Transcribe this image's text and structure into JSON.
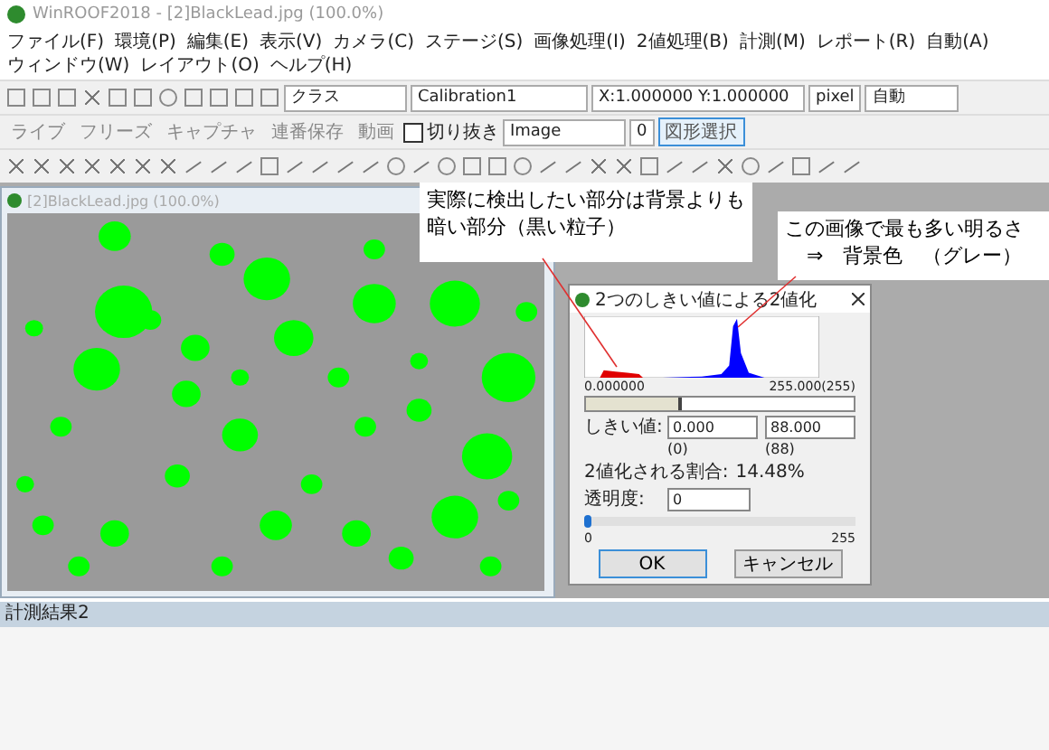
{
  "window": {
    "title": "WinROOF2018 - [2]BlackLead.jpg (100.0%)"
  },
  "menu": [
    "ファイル(F)",
    "環境(P)",
    "編集(E)",
    "表示(V)",
    "カメラ(C)",
    "ステージ(S)",
    "画像処理(I)",
    "2値処理(B)",
    "計測(M)",
    "レポート(R)",
    "自動(A)",
    "ウィンドウ(W)",
    "レイアウト(O)",
    "ヘルプ(H)"
  ],
  "toolbar": {
    "class_combo": "クラス",
    "calibration": "Calibration1",
    "coordinates": "X:1.000000 Y:1.000000",
    "unit": "pixel",
    "zoom_mode": "自動",
    "live": "ライブ",
    "freeze": "フリーズ",
    "capture": "キャプチャ",
    "sequential_save": "連番保存",
    "movie": "動画",
    "crop": {
      "label": "切り抜き",
      "checked": false
    },
    "layer": "Image",
    "layer_index": "0",
    "shape_select": {
      "label": "図形選択",
      "selected": true
    }
  },
  "image_window": {
    "title": "[2]BlackLead.jpg (100.0%)"
  },
  "callouts": [
    {
      "lines": [
        "実際に検出したい部分は背景よりも",
        "暗い部分（黒い粒子）"
      ]
    },
    {
      "lines": [
        "この画像で最も多い明るさ",
        "⇒　背景色　（グレー）"
      ]
    }
  ],
  "dialog": {
    "title": "2つのしきい値による2値化",
    "histogram_min": "0.000000",
    "histogram_max": "255.000(255)",
    "threshold_slider": {
      "level": 0.345
    },
    "threshold_label": "しきい値:",
    "threshold_low": "0.000",
    "threshold_high": "88.000",
    "threshold_low_note": "(0)",
    "threshold_high_note": "(88)",
    "ratio_label": "2値化される割合:",
    "ratio": "14.48%",
    "opacity_label": "透明度:",
    "opacity": "0",
    "opacity_slider": {
      "level": 0
    },
    "opacity_min": "0",
    "opacity_max": "255",
    "buttons": [
      "OK",
      "キャンセル"
    ]
  },
  "results_panel": {
    "title": "計測結果2"
  }
}
